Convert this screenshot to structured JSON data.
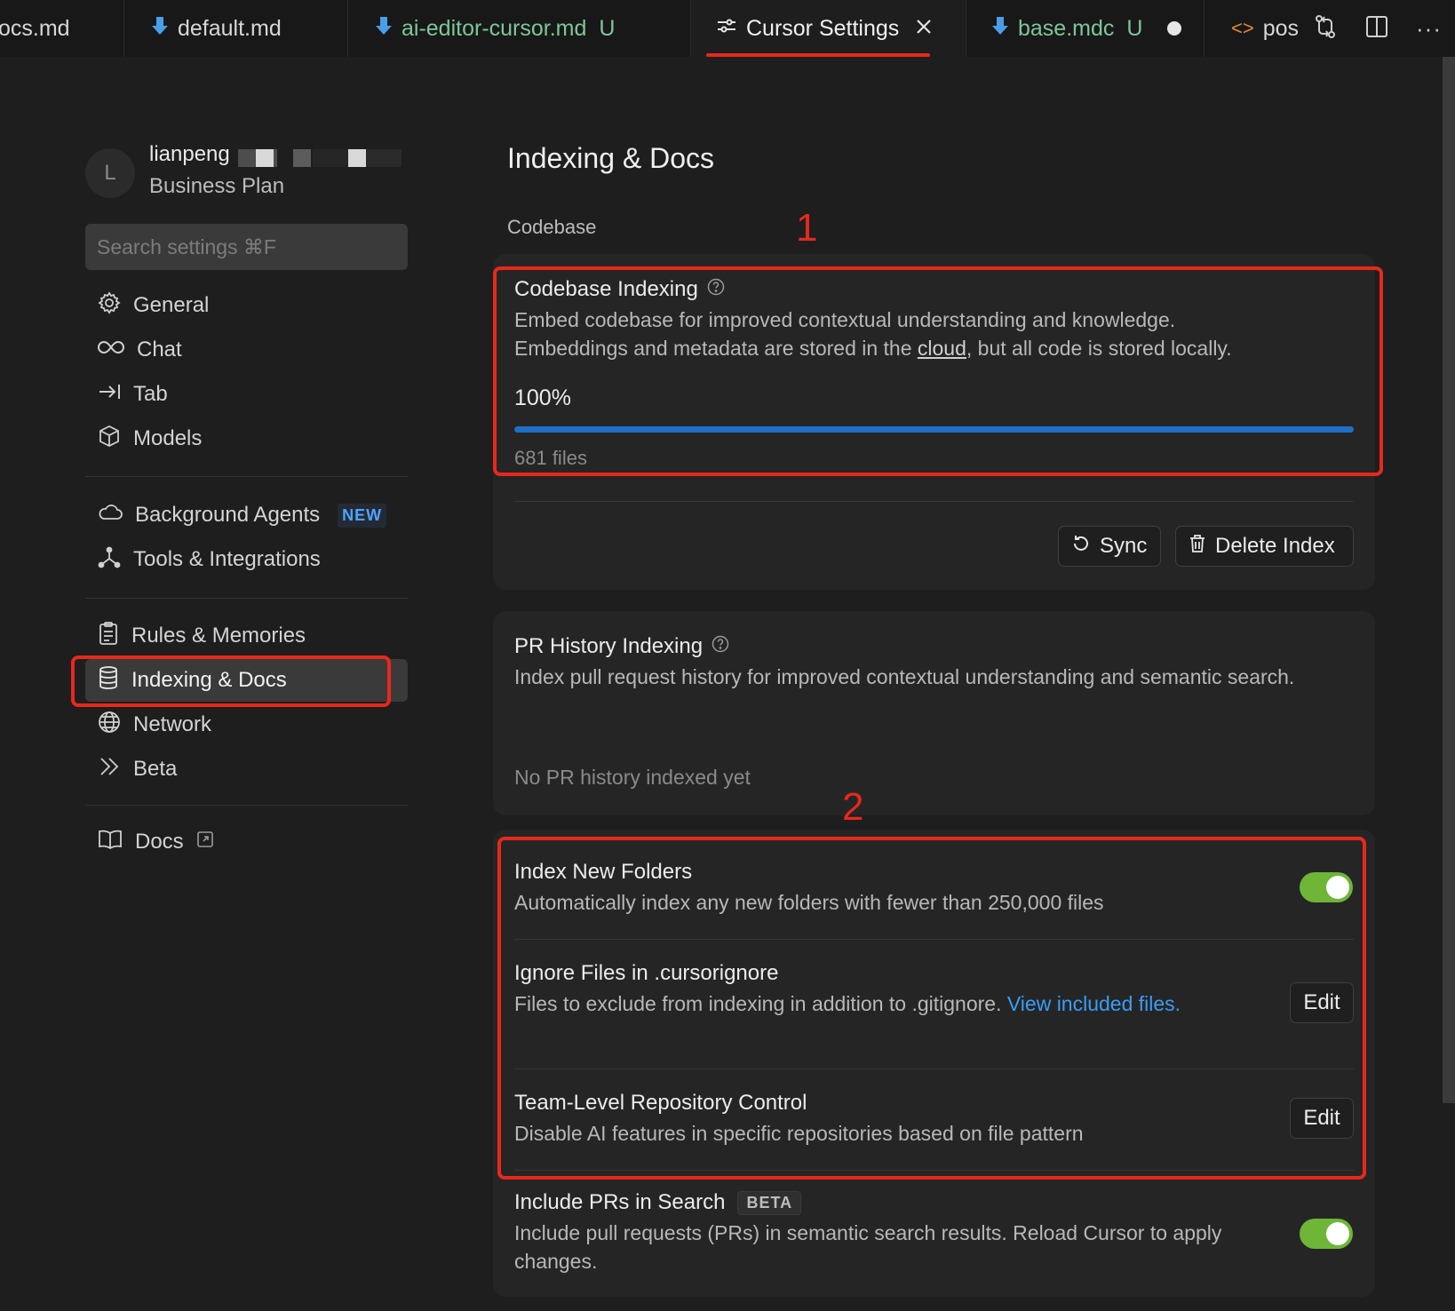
{
  "tabs": [
    {
      "label": "ocs.md",
      "status": ""
    },
    {
      "label": "default.md",
      "status": ""
    },
    {
      "label": "ai-editor-cursor.md",
      "status": "U"
    },
    {
      "label": "Cursor Settings",
      "status": ""
    },
    {
      "label": "base.mdc",
      "status": "U"
    },
    {
      "label": "pos",
      "status": ""
    }
  ],
  "user": {
    "avatar_initial": "L",
    "name": "lianpeng",
    "plan": "Business Plan"
  },
  "search": {
    "placeholder": "Search settings ⌘F"
  },
  "sidebar": {
    "items": [
      {
        "label": "General",
        "icon": "gear-icon"
      },
      {
        "label": "Chat",
        "icon": "infinity-icon"
      },
      {
        "label": "Tab",
        "icon": "tab-arrow-icon"
      },
      {
        "label": "Models",
        "icon": "cube-icon"
      },
      {
        "label": "Background Agents",
        "icon": "cloud-icon",
        "badge": "NEW"
      },
      {
        "label": "Tools & Integrations",
        "icon": "nodes-icon"
      },
      {
        "label": "Rules & Memories",
        "icon": "clipboard-icon"
      },
      {
        "label": "Indexing & Docs",
        "icon": "database-icon",
        "active": true
      },
      {
        "label": "Network",
        "icon": "globe-icon"
      },
      {
        "label": "Beta",
        "icon": "double-chevron-icon"
      },
      {
        "label": "Docs",
        "icon": "book-icon"
      }
    ]
  },
  "main": {
    "title": "Indexing & Docs",
    "section_label": "Codebase",
    "codebase_indexing": {
      "title": "Codebase Indexing",
      "desc_line1": "Embed codebase for improved contextual understanding and knowledge.",
      "desc_line2_pre": "Embeddings and metadata are stored in the ",
      "desc_link": "cloud",
      "desc_line2_post": ", but all code is stored locally.",
      "progress_text": "100%",
      "progress": 1.0,
      "files": "681 files",
      "sync_label": "Sync",
      "delete_label": "Delete Index"
    },
    "pr_history": {
      "title": "PR History Indexing",
      "desc": "Index pull request history for improved contextual understanding and semantic search.",
      "status": "No PR history indexed yet"
    },
    "index_new_folders": {
      "title": "Index New Folders",
      "desc": "Automatically index any new folders with fewer than 250,000 files",
      "enabled": true
    },
    "ignore_files": {
      "title": "Ignore Files in .cursorignore",
      "desc": "Files to exclude from indexing in addition to .gitignore. ",
      "link": "View included files.",
      "edit_label": "Edit"
    },
    "team_repo": {
      "title": "Team-Level Repository Control",
      "desc": "Disable AI features in specific repositories based on file pattern",
      "edit_label": "Edit"
    },
    "include_prs": {
      "title": "Include PRs in Search",
      "badge": "BETA",
      "desc": "Include pull requests (PRs) in semantic search results. Reload Cursor to apply changes.",
      "enabled": true
    }
  },
  "annotations": {
    "marker_1": "1",
    "marker_2": "2"
  },
  "colors": {
    "accent_red": "#e8281d",
    "progress_blue": "#1f6fc6",
    "toggle_green": "#6eb538",
    "link_blue": "#3b9cf5"
  }
}
